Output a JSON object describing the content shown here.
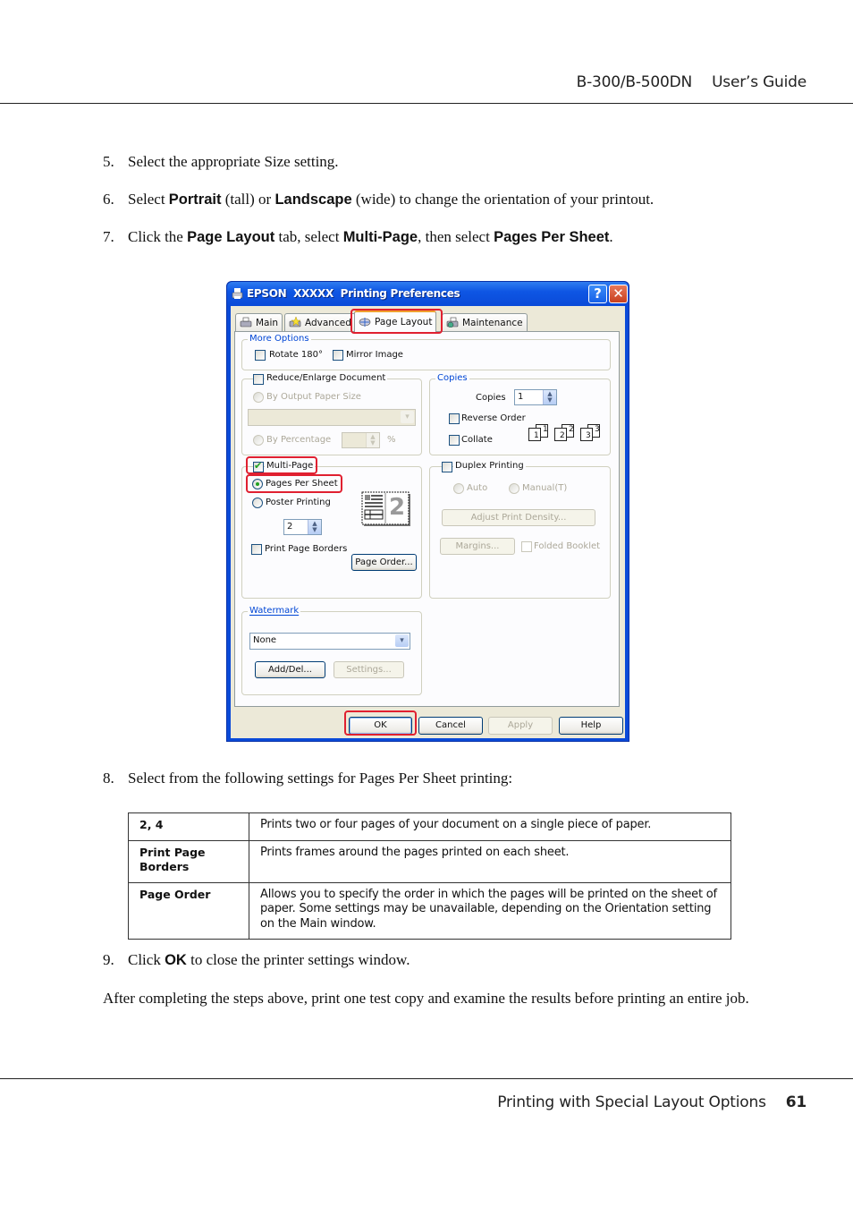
{
  "header": {
    "model": "B-300/B-500DN",
    "guide": "User’s Guide"
  },
  "steps": {
    "s5": {
      "num": "5.",
      "text": "Select the appropriate Size setting."
    },
    "s6": {
      "num": "6.",
      "t1": "Select ",
      "b1": "Portrait",
      "t2": " (tall) or ",
      "b2": "Landscape",
      "t3": " (wide) to change the orientation of your printout."
    },
    "s7": {
      "num": "7.",
      "t1": "Click the ",
      "b1": "Page Layout",
      "t2": " tab, select ",
      "b2": "Multi-Page",
      "t3": ", then select ",
      "b3": "Pages Per Sheet",
      "t4": "."
    },
    "s8": {
      "num": "8.",
      "text": "Select from the following settings for Pages Per Sheet printing:"
    },
    "s9": {
      "num": "9.",
      "t1": "Click ",
      "b1": "OK",
      "t2": " to close the printer settings window."
    }
  },
  "closing_paragraph": "After completing the steps above, print one test copy and examine the results before printing an entire job.",
  "dialog": {
    "title": "EPSON  XXXXX  Printing Preferences",
    "help_glyph": "?",
    "close_glyph": "✕",
    "tabs": [
      {
        "label": "Main",
        "active": false
      },
      {
        "label": "Advanced",
        "active": false
      },
      {
        "label": "Page Layout",
        "active": true
      },
      {
        "label": "Maintenance",
        "active": false
      }
    ],
    "more_options": {
      "label": "More Options",
      "rotate": {
        "label": "Rotate 180°",
        "checked": false
      },
      "mirror": {
        "label": "Mirror Image",
        "checked": false
      }
    },
    "reduce_enlarge": {
      "label": "Reduce/Enlarge Document",
      "checked": false,
      "by_output": "By Output Paper Size",
      "output_value": "",
      "by_percentage": "By Percentage",
      "percentage_value": "",
      "percent_sign": "%"
    },
    "copies": {
      "label": "Copies",
      "copies_label": "Copies",
      "copies_value": "1",
      "reverse_order": {
        "label": "Reverse Order",
        "checked": false
      },
      "collate": {
        "label": "Collate",
        "checked": false
      },
      "collate_icons": [
        "1",
        "2",
        "3"
      ]
    },
    "multi_page": {
      "label": "Multi-Page",
      "checked": true,
      "pages_per_sheet": {
        "label": "Pages Per Sheet",
        "selected": true
      },
      "poster_printing": {
        "label": "Poster Printing",
        "selected": false
      },
      "pages_value": "2",
      "preview_number": "2",
      "print_page_borders": {
        "label": "Print Page Borders",
        "checked": false
      },
      "page_order_button": "Page Order..."
    },
    "duplex": {
      "label": "Duplex Printing",
      "checked": false,
      "auto": "Auto",
      "manual": "Manual(T)",
      "adjust_density_button": "Adjust Print Density...",
      "margins_button": "Margins...",
      "folded_booklet": {
        "label": "Folded Booklet",
        "checked": false
      }
    },
    "watermark": {
      "label": "Watermark",
      "value": "None",
      "add_del_button": "Add/Del...",
      "settings_button": "Settings..."
    },
    "buttons": {
      "ok": "OK",
      "cancel": "Cancel",
      "apply": "Apply",
      "help": "Help"
    },
    "colors": {
      "titlebar": "#0a4ad8",
      "highlight": "#e02030",
      "groupbox_label": "#0046d5",
      "check": "#21a121"
    }
  },
  "settings_table": {
    "rows": [
      {
        "key": "2, 4",
        "value": "Prints two or four pages of your document on a single piece of paper."
      },
      {
        "key": "Print Page Borders",
        "value": "Prints frames around the pages printed on each sheet."
      },
      {
        "key": "Page Order",
        "value": "Allows you to specify the order in which the pages will be printed on the sheet of paper. Some settings may be unavailable, depending on the Orientation setting on the Main window."
      }
    ]
  },
  "footer": {
    "section": "Printing with Special Layout Options",
    "page": "61"
  }
}
